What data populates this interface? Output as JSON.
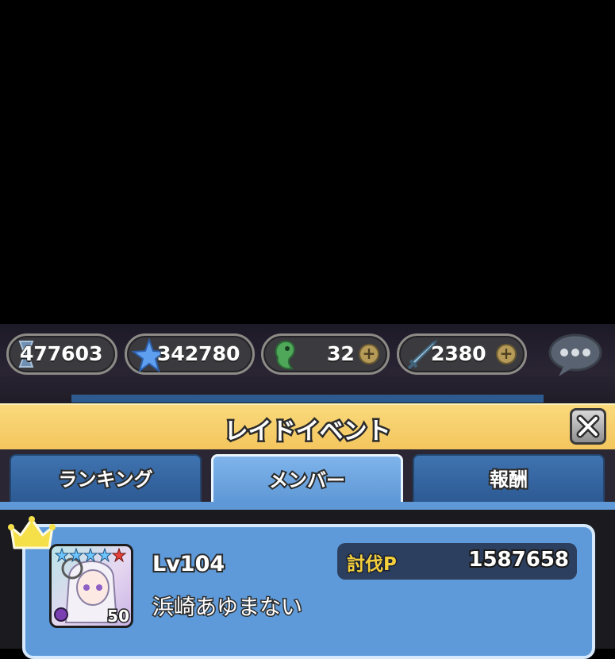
{
  "currencies": [
    {
      "name": "hourglass-currency",
      "value": "477603"
    },
    {
      "name": "star-currency",
      "value": "342780"
    },
    {
      "name": "soul-currency",
      "value": "32"
    },
    {
      "name": "sword-currency",
      "value": "2380"
    }
  ],
  "header": {
    "title": "レイドイベント"
  },
  "tabs": [
    {
      "label": "ランキング",
      "active": false
    },
    {
      "label": "メンバー",
      "active": true
    },
    {
      "label": "報酬",
      "active": false
    }
  ],
  "member": {
    "level": "Lv104",
    "name": "浜崎あゆまない",
    "avatar_level": "50",
    "score_label": "討伐P",
    "score_value": "1587658"
  },
  "colors": {
    "title_bar": "#f3c55d",
    "tab_active": "#5f98d6",
    "tab_inactive": "#2d5a93",
    "score_label": "#f4cf3c"
  }
}
